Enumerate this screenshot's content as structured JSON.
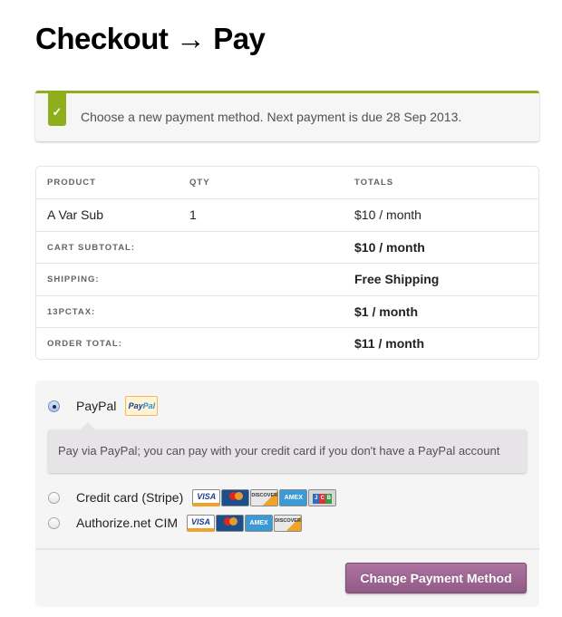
{
  "page": {
    "title": "Checkout → Pay"
  },
  "notice": {
    "icon": "checkmark-icon",
    "icon_glyph": "✓",
    "message": "Choose a new payment method. Next payment is due 28 Sep 2013.",
    "accent_color": "#8fae1b"
  },
  "order_table": {
    "headers": [
      "PRODUCT",
      "QTY",
      "TOTALS"
    ],
    "items": [
      {
        "product": "A Var Sub",
        "qty": "1",
        "total": "$10 / month"
      }
    ],
    "summary": [
      {
        "label": "CART SUBTOTAL:",
        "value": "$10 / month"
      },
      {
        "label": "SHIPPING:",
        "value": "Free Shipping"
      },
      {
        "label": "13PCTAX:",
        "value": "$1 / month"
      },
      {
        "label": "ORDER TOTAL:",
        "value": "$11 / month"
      }
    ]
  },
  "payment": {
    "methods": [
      {
        "label": "PayPal",
        "selected": true,
        "logo": {
          "pay": "Pay",
          "pal": "Pal"
        },
        "description": "Pay via PayPal; you can pay with your credit card if you don't have a PayPal account"
      },
      {
        "label": "Credit card (Stripe)",
        "selected": false,
        "cards": [
          "VISA",
          "MasterCard",
          "DISCOVER",
          "AMEX",
          "JCB"
        ]
      },
      {
        "label": "Authorize.net CIM",
        "selected": false,
        "cards": [
          "VISA",
          "MasterCard",
          "AMEX",
          "DISCOVER"
        ]
      }
    ],
    "card_text": {
      "visa": "VISA",
      "discover": "DISCOVER",
      "amex": "AMEX",
      "jcb_j": "J",
      "jcb_c": "C",
      "jcb_b": "B"
    },
    "submit_label": "Change Payment Method",
    "button_color": "#a46497"
  }
}
